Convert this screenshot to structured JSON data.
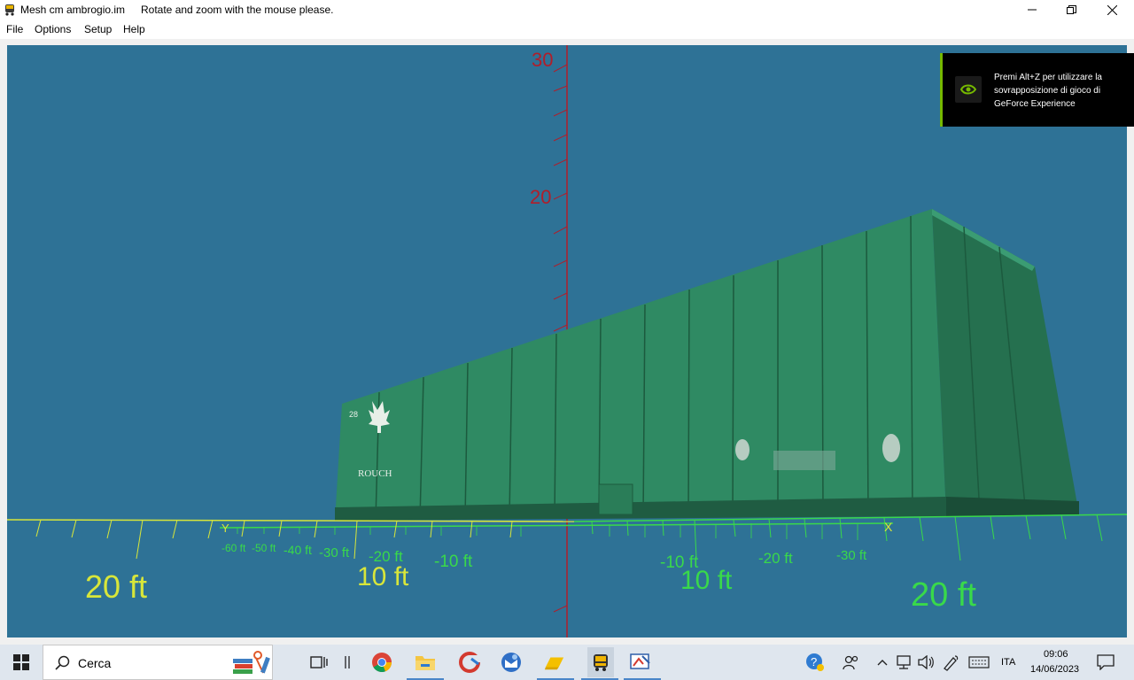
{
  "window": {
    "title": "Mesh cm ambrogio.im",
    "subtitle": "Rotate and zoom with the mouse please."
  },
  "menu": [
    "File",
    "Options",
    "Setup",
    "Help"
  ],
  "scene": {
    "z_labels": [
      "30",
      "20"
    ],
    "y_axis_label": "Y",
    "x_axis_label": "X",
    "left_ticks": [
      "-60 ft",
      "-50 ft",
      "-40 ft",
      "-30 ft",
      "-20 ft",
      "-10 ft"
    ],
    "right_ticks": [
      "-10 ft",
      "-20 ft",
      "-30 ft"
    ],
    "big_labels": [
      "20 ft",
      "10 ft",
      "10 ft",
      "20 ft"
    ],
    "container_brand": "ROUCH",
    "container_number": "28",
    "colors": {
      "background": "#2e7296",
      "axis_z": "#b01e2a",
      "axis_yellow": "#d8e63a",
      "axis_green": "#39d94a",
      "container": "#2f8a63"
    }
  },
  "overlay": {
    "text": "Premi Alt+Z per utilizzare la sovrapposizione di gioco di GeForce Experience"
  },
  "taskbar": {
    "search_placeholder": "Cerca",
    "language": "ITA",
    "time": "09:06",
    "date": "14/06/2023",
    "icons": [
      "windows-start-icon",
      "search-icon",
      "task-view-icon",
      "widgets-icon",
      "chrome-icon",
      "file-explorer-icon",
      "ccleaner-icon",
      "thunderbird-icon",
      "folder-drive-icon",
      "bus-app-icon",
      "paint-app-icon",
      "help-icon",
      "people-icon",
      "chevron-up-icon",
      "network-icon",
      "volume-icon",
      "pen-icon",
      "keyboard-icon",
      "notifications-icon"
    ]
  }
}
